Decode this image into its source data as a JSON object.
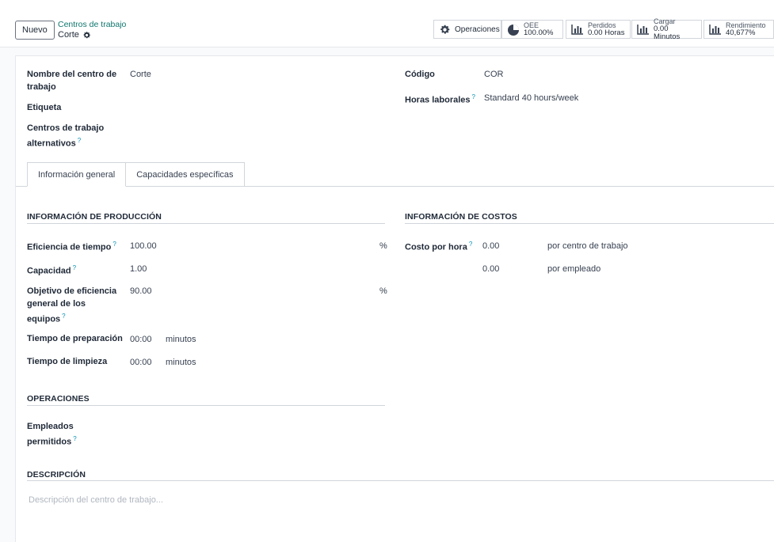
{
  "control_panel": {
    "new_label": "Nuevo",
    "breadcrumb_parent": "Centros de trabajo",
    "breadcrumb_current": "Corte",
    "stats": {
      "operations": "Operaciones",
      "oee_label": "OEE",
      "oee_value": "100.00%",
      "lost_label": "Perdidos",
      "lost_value": "0.00 Horas",
      "load_label": "Cargar",
      "load_value": "0.00 Minutos",
      "performance_label": "Rendimiento",
      "performance_value": "40,677%"
    }
  },
  "form": {
    "name_label": "Nombre del centro de trabajo",
    "name_value": "Corte",
    "tag_label": "Etiqueta",
    "alt_label": "Centros de trabajo alternativos",
    "code_label": "Código",
    "code_value": "COR",
    "hours_label": "Horas laborales",
    "hours_value": "Standard 40 hours/week"
  },
  "tabs": [
    "Información general",
    "Capacidades específicas"
  ],
  "production": {
    "title": "INFORMACIÓN DE PRODUCCIÓN",
    "time_eff_label": "Eficiencia de tiempo",
    "time_eff_value": "100.00",
    "time_eff_unit": "%",
    "capacity_label": "Capacidad",
    "capacity_value": "1.00",
    "oee_target_label": "Objetivo de eficiencia general de los equipos",
    "oee_target_value": "90.00",
    "oee_target_unit": "%",
    "setup_label": "Tiempo de preparación",
    "setup_value": "00:00",
    "setup_unit": "minutos",
    "cleanup_label": "Tiempo de limpieza",
    "cleanup_value": "00:00",
    "cleanup_unit": "minutos"
  },
  "costs": {
    "title": "INFORMACIÓN DE COSTOS",
    "cost_label": "Costo por hora",
    "cost_value": "0.00",
    "cost_unit": "por centro de trabajo",
    "employee_value": "0.00",
    "employee_unit": "por empleado"
  },
  "operations": {
    "title": "OPERACIONES",
    "employees_label": "Empleados permitidos"
  },
  "description": {
    "title": "DESCRIPCIÓN",
    "placeholder": "Descripción del centro de trabajo..."
  },
  "help_mark": "?"
}
